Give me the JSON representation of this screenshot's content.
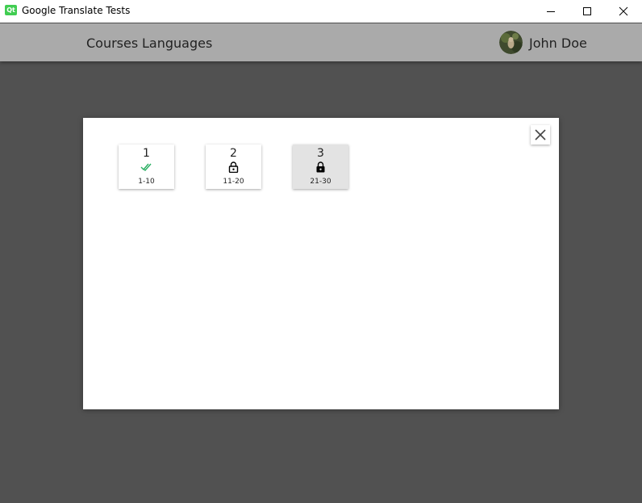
{
  "window": {
    "icon_label": "Qt",
    "title": "Google Translate Tests"
  },
  "nav": {
    "items": [
      {
        "label": "Courses"
      },
      {
        "label": "Languages"
      }
    ]
  },
  "user": {
    "name": "John Doe"
  },
  "lessons": [
    {
      "number": "1",
      "range": "1-10",
      "status": "completed",
      "icon": "double-check-icon",
      "color": "#27ae60"
    },
    {
      "number": "2",
      "range": "11-20",
      "status": "unlocked",
      "icon": "lock-open-icon",
      "color": "#000000"
    },
    {
      "number": "3",
      "range": "21-30",
      "status": "locked",
      "icon": "lock-icon",
      "color": "#000000"
    }
  ],
  "colors": {
    "background": "#515151",
    "header": "#aaaaaa",
    "locked_card": "#e3e3e3",
    "check": "#27ae60"
  }
}
